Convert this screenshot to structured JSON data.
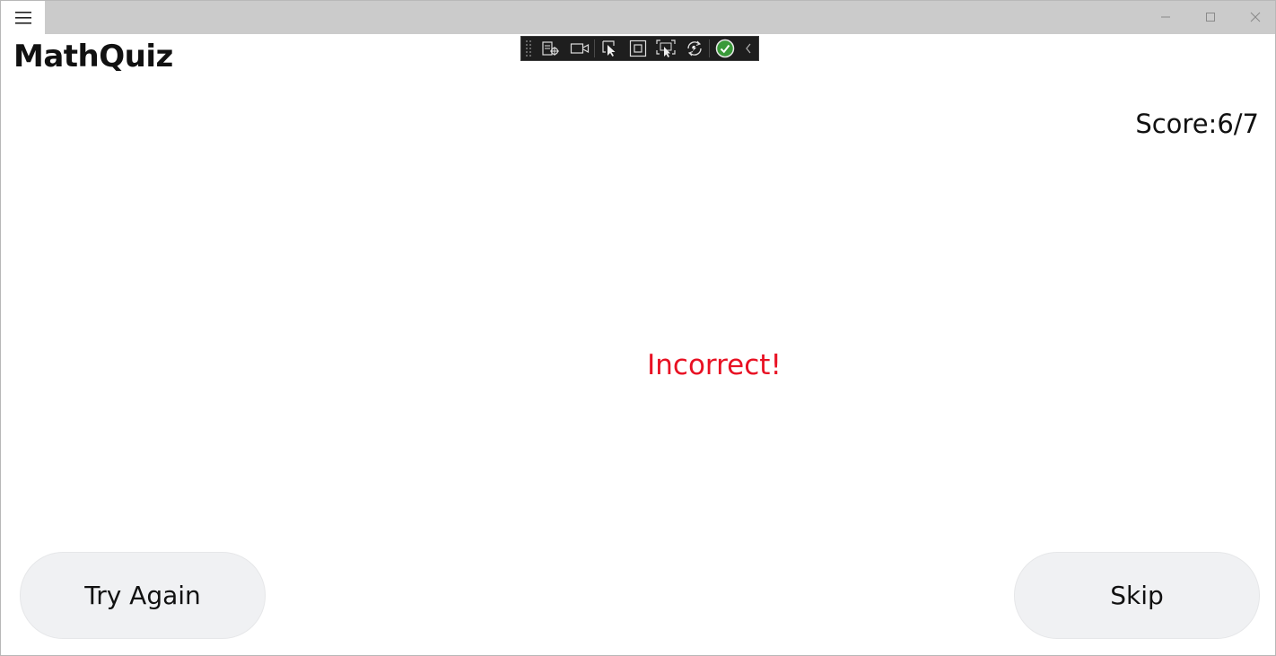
{
  "app": {
    "title": "MathQuiz"
  },
  "titlebar": {
    "menu_icon": "hamburger-icon",
    "controls": [
      "minimize-icon",
      "maximize-icon",
      "close-icon"
    ]
  },
  "dev_toolbar": {
    "tools": [
      "live-visual-tree-icon",
      "record-icon",
      "select-element-icon",
      "display-layout-adorners-icon",
      "track-focus-icon",
      "hot-reload-icon",
      "binding-status-icon",
      "collapse-chevron-icon"
    ]
  },
  "quiz": {
    "score": "Score:6/7",
    "feedback": "Incorrect!",
    "feedback_color": "#e81123"
  },
  "actions": {
    "try_again_label": "Try Again",
    "skip_label": "Skip"
  }
}
